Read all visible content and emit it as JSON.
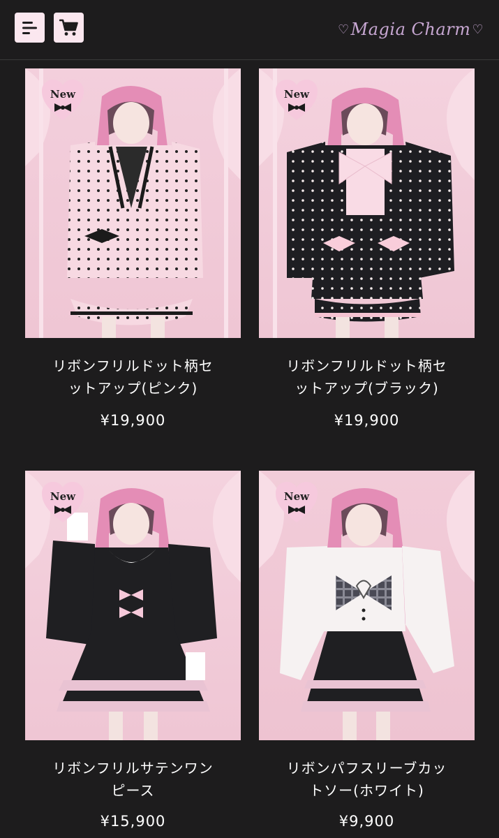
{
  "header": {
    "menu_icon": "menu-icon",
    "cart_icon": "cart-icon",
    "logo_text": "Magia Charm"
  },
  "colors": {
    "background": "#1d1c1d",
    "button_bg": "#fbe7ef",
    "logo": "#c7a7d2",
    "badge_pink": "#f6c9dd",
    "text": "#ffffff"
  },
  "products": [
    {
      "badge": "New",
      "title_line1": "リボンフリルドット柄セ",
      "title_line2": "ットアップ(ピンク)",
      "price": "¥19,900"
    },
    {
      "badge": "New",
      "title_line1": "リボンフリルドット柄セ",
      "title_line2": "ットアップ(ブラック)",
      "price": "¥19,900"
    },
    {
      "badge": "New",
      "title_line1": "リボンフリルサテンワン",
      "title_line2": "ピース",
      "price": "¥15,900"
    },
    {
      "badge": "New",
      "title_line1": "リボンパフスリーブカッ",
      "title_line2": "トソー(ホワイト)",
      "price": "¥9,900"
    }
  ]
}
